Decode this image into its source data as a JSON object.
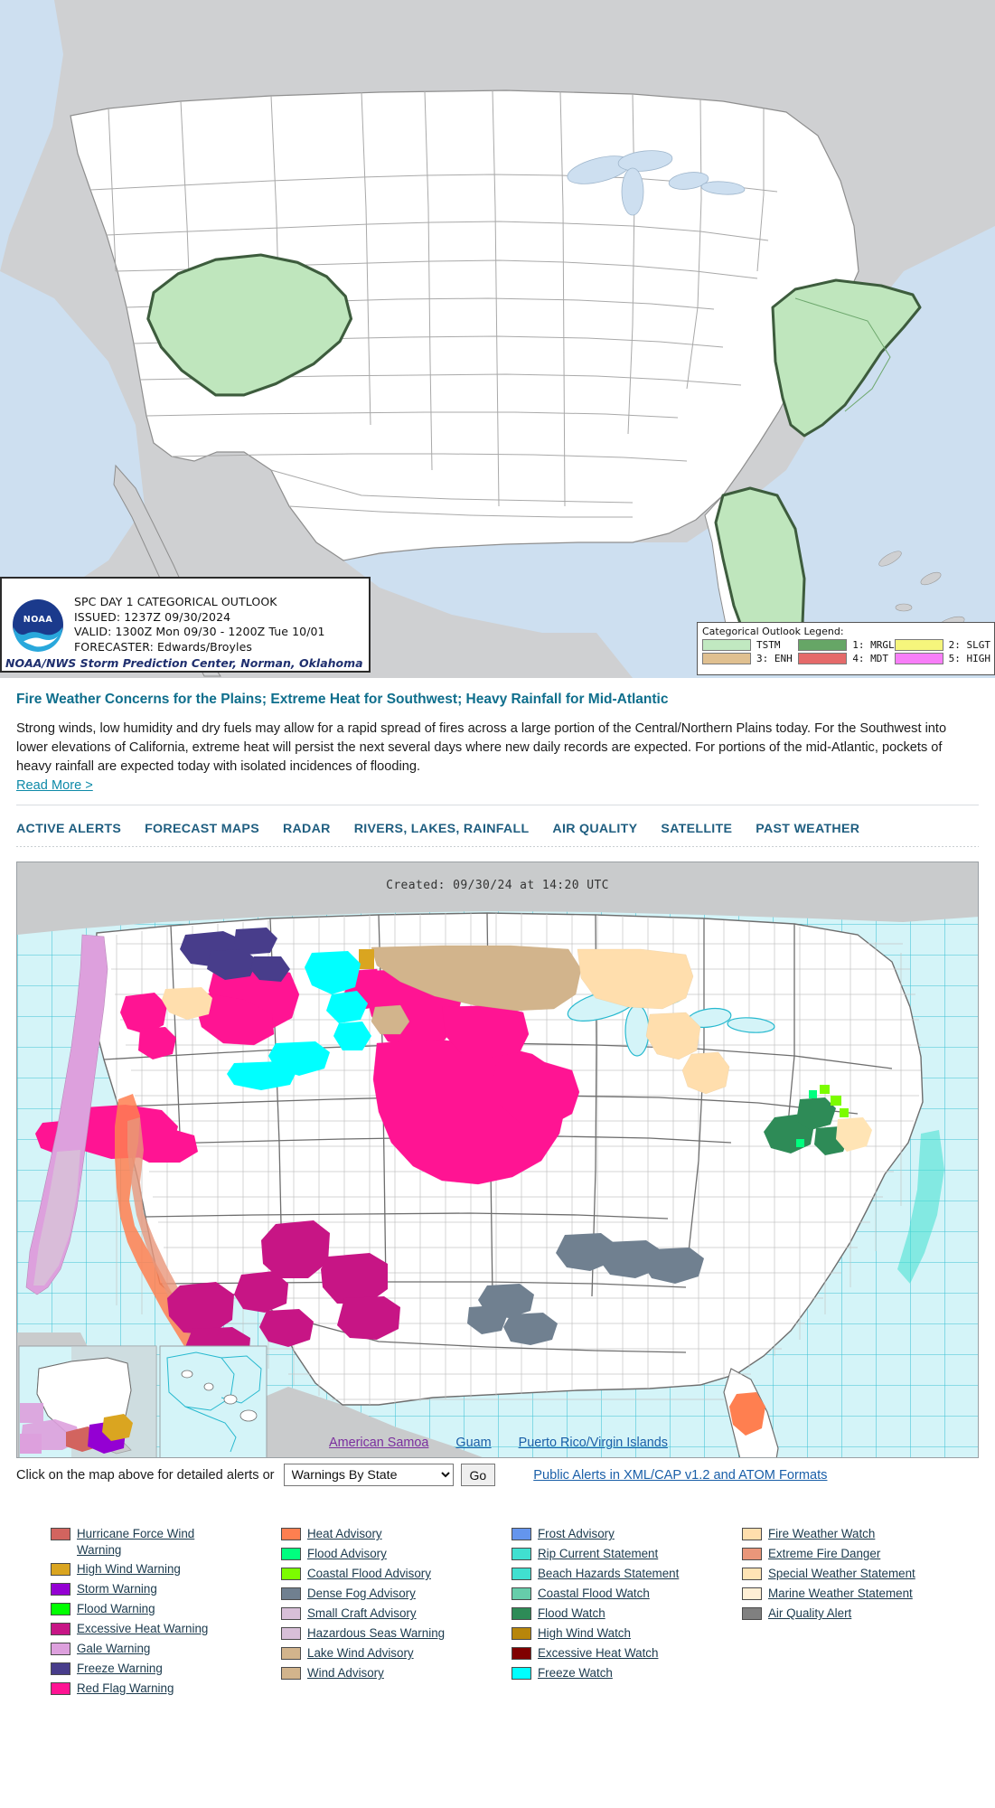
{
  "spc_map": {
    "infobox": {
      "logo_alt": "NOAA logo",
      "line1": "SPC DAY 1 CATEGORICAL OUTLOOK",
      "line2": "ISSUED: 1237Z 09/30/2024",
      "line3": "VALID: 1300Z Mon 09/30 - 1200Z Tue 10/01",
      "line4": "FORECASTER: Edwards/Broyles",
      "credit": "NOAA/NWS Storm Prediction Center, Norman, Oklahoma"
    },
    "legend": {
      "title": "Categorical Outlook Legend:",
      "items": [
        {
          "label": "TSTM",
          "color": "#c1e9c1"
        },
        {
          "label": "1: MRGL",
          "color": "#66a666"
        },
        {
          "label": "2: SLGT",
          "color": "#f6f67c"
        },
        {
          "label": "3: ENH",
          "color": "#e0c090"
        },
        {
          "label": "4: MDT",
          "color": "#e56a6a"
        },
        {
          "label": "5: HIGH",
          "color": "#f87ef8"
        }
      ]
    },
    "colors": {
      "land_outside": "#cfd0d2",
      "land_us": "#ffffff",
      "water": "#cddff0",
      "tstm_fill": "#bfe6bd",
      "tstm_outline": "#3d5c3d",
      "border": "#9a9a9a"
    }
  },
  "headline": {
    "title": "Fire Weather Concerns for the Plains; Extreme Heat for Southwest; Heavy Rainfall for Mid-Atlantic",
    "body": "Strong winds, low humidity and dry fuels may allow for a rapid spread of fires across a large portion of the Central/Northern Plains today. For the Southwest into lower elevations of California, extreme heat will persist the next several days where new daily records are expected. For portions of the mid-Atlantic, pockets of heavy rainfall are expected today with isolated incidences of flooding.",
    "read_more": "Read More >"
  },
  "nav": {
    "tabs": [
      {
        "label": "ACTIVE ALERTS"
      },
      {
        "label": "FORECAST MAPS"
      },
      {
        "label": "RADAR"
      },
      {
        "label": "RIVERS, LAKES, RAINFALL"
      },
      {
        "label": "AIR QUALITY"
      },
      {
        "label": "SATELLITE"
      },
      {
        "label": "PAST WEATHER"
      }
    ]
  },
  "alerts_map": {
    "created": "Created: 09/30/24 at 14:20 UTC",
    "territory_links": [
      {
        "label": "American Samoa",
        "visited": true
      },
      {
        "label": "Guam",
        "visited": false
      },
      {
        "label": "Puerto Rico/Virgin Islands",
        "visited": false
      }
    ],
    "colors": {
      "water": "#d4f4f8",
      "outside_land": "#c9cbcc",
      "us_land": "#ffffff",
      "county_line": "#c2c2c2",
      "state_line": "#6e6e6e",
      "marine_grid": "#27b9cf"
    }
  },
  "map_controls": {
    "prompt": "Click on the map above for detailed alerts or",
    "select_value": "Warnings By State",
    "select_options": [
      "Warnings By State"
    ],
    "go_label": "Go",
    "cap_link": "Public Alerts in XML/CAP v1.2 and ATOM Formats"
  },
  "legend_columns": [
    [
      {
        "label": "Hurricane Force Wind Warning",
        "color": "#d2645f"
      },
      {
        "label": "High Wind Warning",
        "color": "#daa520"
      },
      {
        "label": "Storm Warning",
        "color": "#9400d3"
      },
      {
        "label": "Flood Warning",
        "color": "#00ff00"
      },
      {
        "label": "Excessive Heat Warning",
        "color": "#c71585"
      },
      {
        "label": "Gale Warning",
        "color": "#dda0dd"
      },
      {
        "label": "Freeze Warning",
        "color": "#483d8b"
      },
      {
        "label": "Red Flag Warning",
        "color": "#ff1493"
      }
    ],
    [
      {
        "label": "Heat Advisory",
        "color": "#ff7f50"
      },
      {
        "label": "Flood Advisory",
        "color": "#00ff7f"
      },
      {
        "label": "Coastal Flood Advisory",
        "color": "#7cfc00"
      },
      {
        "label": "Dense Fog Advisory",
        "color": "#708090"
      },
      {
        "label": "Small Craft Advisory",
        "color": "#d8bfd8"
      },
      {
        "label": "Hazardous Seas Warning",
        "color": "#d8bfd8"
      },
      {
        "label": "Lake Wind Advisory",
        "color": "#d2b48c"
      },
      {
        "label": "Wind Advisory",
        "color": "#d2b48c"
      }
    ],
    [
      {
        "label": "Frost Advisory",
        "color": "#6495ed"
      },
      {
        "label": "Rip Current Statement",
        "color": "#40e0d0"
      },
      {
        "label": "Beach Hazards Statement",
        "color": "#40e0d0"
      },
      {
        "label": "Coastal Flood Watch",
        "color": "#66cdaa"
      },
      {
        "label": "Flood Watch",
        "color": "#2e8b57"
      },
      {
        "label": "High Wind Watch",
        "color": "#b8860b"
      },
      {
        "label": "Excessive Heat Watch",
        "color": "#800000"
      },
      {
        "label": "Freeze Watch",
        "color": "#00ffff"
      }
    ],
    [
      {
        "label": "Fire Weather Watch",
        "color": "#ffdead"
      },
      {
        "label": "Extreme Fire Danger",
        "color": "#e9967a"
      },
      {
        "label": "Special Weather Statement",
        "color": "#ffe4b5"
      },
      {
        "label": "Marine Weather Statement",
        "color": "#ffefd5"
      },
      {
        "label": "Air Quality Alert",
        "color": "#808080"
      }
    ]
  ]
}
